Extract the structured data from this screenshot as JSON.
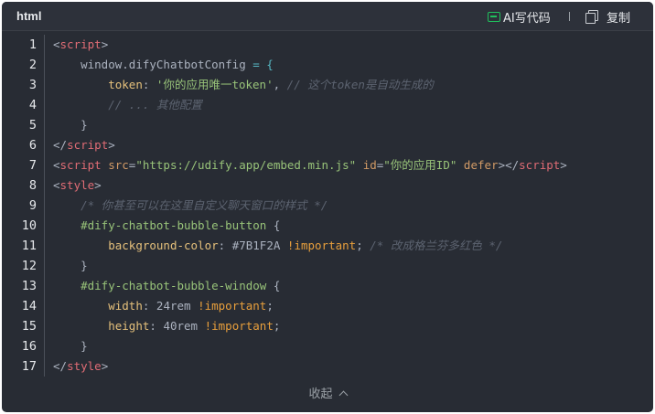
{
  "header": {
    "language": "html",
    "ai_button_label": "AI写代码",
    "copy_button_label": "复制",
    "ai_icon": "ai-code-icon",
    "copy_icon": "copy-icon"
  },
  "line_numbers": [
    "1",
    "2",
    "3",
    "4",
    "5",
    "6",
    "7",
    "8",
    "9",
    "10",
    "11",
    "12",
    "13",
    "14",
    "15",
    "16",
    "17"
  ],
  "code": {
    "l1": {
      "open": "<",
      "tag": "script",
      "close": ">"
    },
    "l2": {
      "indent": "    ",
      "obj": "window.difyChatbotConfig",
      "op": " = {"
    },
    "l3": {
      "indent": "        ",
      "key": "token",
      "colon": ": ",
      "str": "'你的应用唯一token'",
      "comma": ", ",
      "comment": "// 这个token是自动生成的"
    },
    "l4": {
      "indent": "        ",
      "comment": "// ... 其他配置"
    },
    "l5": {
      "indent": "    ",
      "brace": "}"
    },
    "l6": {
      "open": "</",
      "tag": "script",
      "close": ">"
    },
    "l7": {
      "open": "<",
      "tag": "script",
      "sp1": " ",
      "attr1": "src",
      "eq1": "=",
      "val1": "\"https://udify.app/embed.min.js\"",
      "sp2": " ",
      "attr2": "id",
      "eq2": "=",
      "val2": "\"你的应用ID\"",
      "sp3": " ",
      "attr3": "defer",
      "mid": "></",
      "tag2": "script",
      "close": ">"
    },
    "l8": {
      "open": "<",
      "tag": "style",
      "close": ">"
    },
    "l9": {
      "indent": "    ",
      "comment": "/* 你甚至可以在这里自定义聊天窗口的样式 */"
    },
    "l10": {
      "indent": "    ",
      "selector": "#dify-chatbot-bubble-button",
      "brace": " {"
    },
    "l11": {
      "indent": "        ",
      "prop": "background-color",
      "colon": ": ",
      "value": "#7B1F2A ",
      "important": "!important",
      "semi": ";",
      "comment": " /* 改成格兰芬多红色 */"
    },
    "l12": {
      "indent": "    ",
      "brace": "}"
    },
    "l13": {
      "indent": "    ",
      "selector": "#dify-chatbot-bubble-window",
      "brace": " {"
    },
    "l14": {
      "indent": "        ",
      "prop": "width",
      "colon": ": ",
      "value": "24rem ",
      "important": "!important",
      "semi": ";"
    },
    "l15": {
      "indent": "        ",
      "prop": "height",
      "colon": ": ",
      "value": "40rem ",
      "important": "!important",
      "semi": ";"
    },
    "l16": {
      "indent": "    ",
      "brace": "}"
    },
    "l17": {
      "open": "</",
      "tag": "style",
      "close": ">"
    }
  },
  "footer": {
    "collapse_label": "收起",
    "collapse_icon": "chevron-up-icon"
  }
}
